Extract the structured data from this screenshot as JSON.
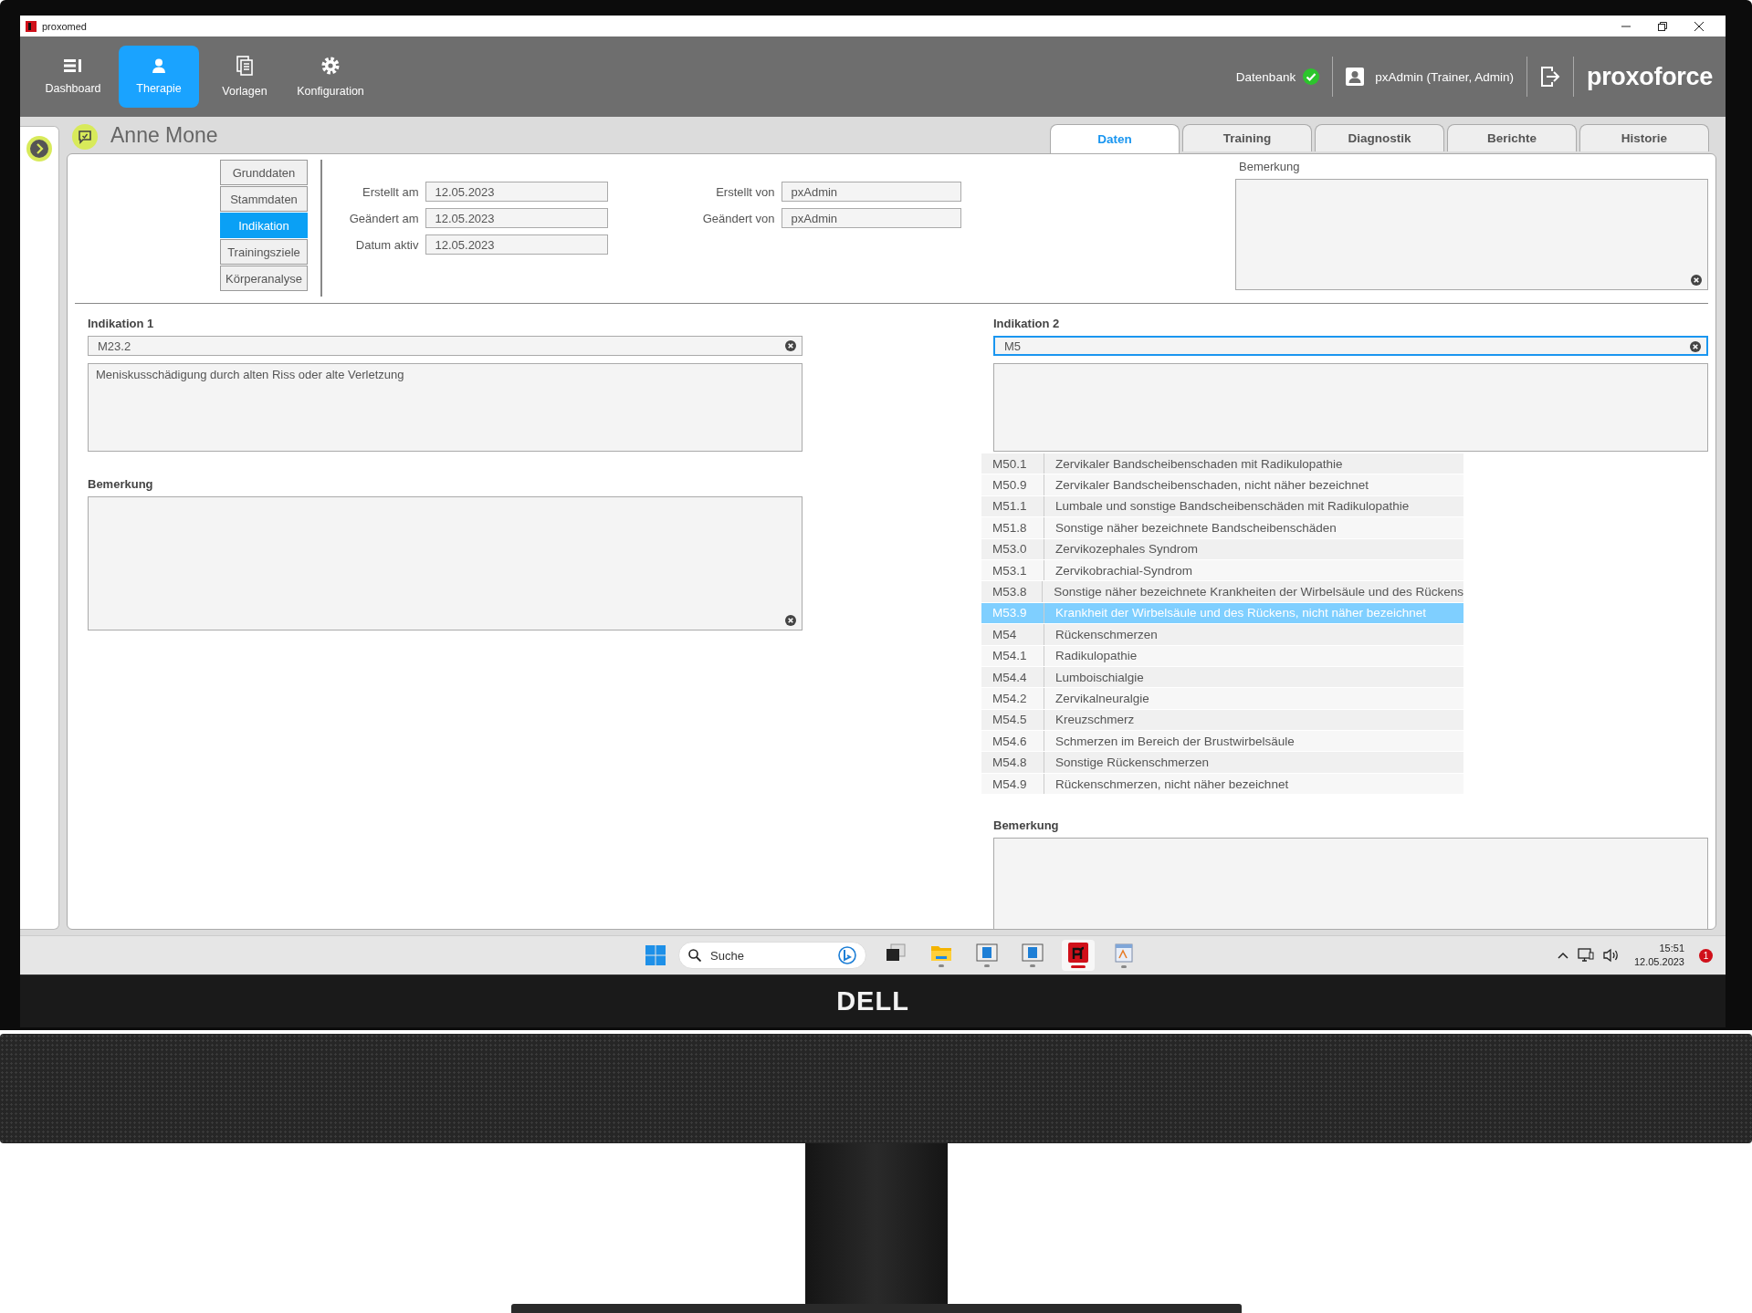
{
  "window": {
    "title": "proxomed"
  },
  "nav": {
    "items": [
      {
        "label": "Dashboard",
        "kind": "dashboard",
        "selected": false
      },
      {
        "label": "Therapie",
        "kind": "person",
        "selected": true
      },
      {
        "label": "Vorlagen",
        "kind": "documents",
        "selected": false
      },
      {
        "label": "Konfiguration",
        "kind": "gear",
        "selected": false
      }
    ],
    "database": {
      "label": "Datenbank",
      "connected": true
    },
    "user": "pxAdmin (Trainer, Admin)",
    "brand": "proxoforce"
  },
  "patient": {
    "name": "Anne Mone"
  },
  "tabs": [
    {
      "label": "Daten",
      "selected": true
    },
    {
      "label": "Training",
      "selected": false
    },
    {
      "label": "Diagnostik",
      "selected": false
    },
    {
      "label": "Berichte",
      "selected": false
    },
    {
      "label": "Historie",
      "selected": false
    }
  ],
  "sections": [
    {
      "label": "Grunddaten",
      "selected": false
    },
    {
      "label": "Stammdaten",
      "selected": false
    },
    {
      "label": "Indikation",
      "selected": true
    },
    {
      "label": "Trainingsziele",
      "selected": false
    },
    {
      "label": "Körperanalyse",
      "selected": false
    }
  ],
  "meta_left": [
    {
      "label": "Erstellt am",
      "value": "12.05.2023"
    },
    {
      "label": "Geändert am",
      "value": "12.05.2023"
    },
    {
      "label": "Datum aktiv",
      "value": "12.05.2023"
    }
  ],
  "meta_right": [
    {
      "label": "Erstellt von",
      "value": "pxAdmin"
    },
    {
      "label": "Geändert von",
      "value": "pxAdmin"
    }
  ],
  "remark": {
    "label": "Bemerkung"
  },
  "indications": [
    {
      "label": "Indikation 1",
      "code": "M23.2",
      "focused": false,
      "description": "Meniskusschädigung durch alten Riss oder alte Verletzung",
      "remark_label": "Bemerkung"
    },
    {
      "label": "Indikation 2",
      "code": "M5",
      "focused": true,
      "suggestions": [
        {
          "code": "M50.1",
          "text": "Zervikaler Bandscheibenschaden mit Radikulopathie",
          "selected": false
        },
        {
          "code": "M50.9",
          "text": "Zervikaler Bandscheibenschaden, nicht näher bezeichnet",
          "selected": false
        },
        {
          "code": "M51.1",
          "text": "Lumbale und sonstige Bandscheibenschäden mit Radikulopathie",
          "selected": false
        },
        {
          "code": "M51.8",
          "text": "Sonstige näher bezeichnete Bandscheibenschäden",
          "selected": false
        },
        {
          "code": "M53.0",
          "text": "Zervikozephales Syndrom",
          "selected": false
        },
        {
          "code": "M53.1",
          "text": "Zervikobrachial-Syndrom",
          "selected": false
        },
        {
          "code": "M53.8",
          "text": "Sonstige näher bezeichnete Krankheiten der Wirbelsäule und des Rückens",
          "selected": false
        },
        {
          "code": "M53.9",
          "text": "Krankheit der Wirbelsäule und des Rückens, nicht näher bezeichnet",
          "selected": true
        },
        {
          "code": "M54",
          "text": "Rückenschmerzen",
          "selected": false
        },
        {
          "code": "M54.1",
          "text": "Radikulopathie",
          "selected": false
        },
        {
          "code": "M54.4",
          "text": "Lumboischialgie",
          "selected": false
        },
        {
          "code": "M54.2",
          "text": "Zervikalneuralgie",
          "selected": false
        },
        {
          "code": "M54.5",
          "text": "Kreuzschmerz",
          "selected": false
        },
        {
          "code": "M54.6",
          "text": "Schmerzen im Bereich der Brustwirbelsäule",
          "selected": false
        },
        {
          "code": "M54.8",
          "text": "Sonstige Rückenschmerzen",
          "selected": false
        },
        {
          "code": "M54.9",
          "text": "Rückenschmerzen, nicht näher bezeichnet",
          "selected": false
        }
      ],
      "remark_label": "Bemerkung"
    }
  ],
  "taskbar": {
    "search_placeholder": "Suche",
    "apps": [
      {
        "kind": "taskview",
        "running": false,
        "active": false
      },
      {
        "kind": "folder",
        "running": true,
        "active": false
      },
      {
        "kind": "window",
        "running": true,
        "active": false
      },
      {
        "kind": "window",
        "running": true,
        "active": false
      },
      {
        "kind": "proxoforce",
        "running": true,
        "active": true
      },
      {
        "kind": "editor",
        "running": true,
        "active": false
      }
    ],
    "time": "15:51",
    "date": "12.05.2023",
    "notifications": "1"
  },
  "monitor": {
    "logo": "DELL"
  }
}
